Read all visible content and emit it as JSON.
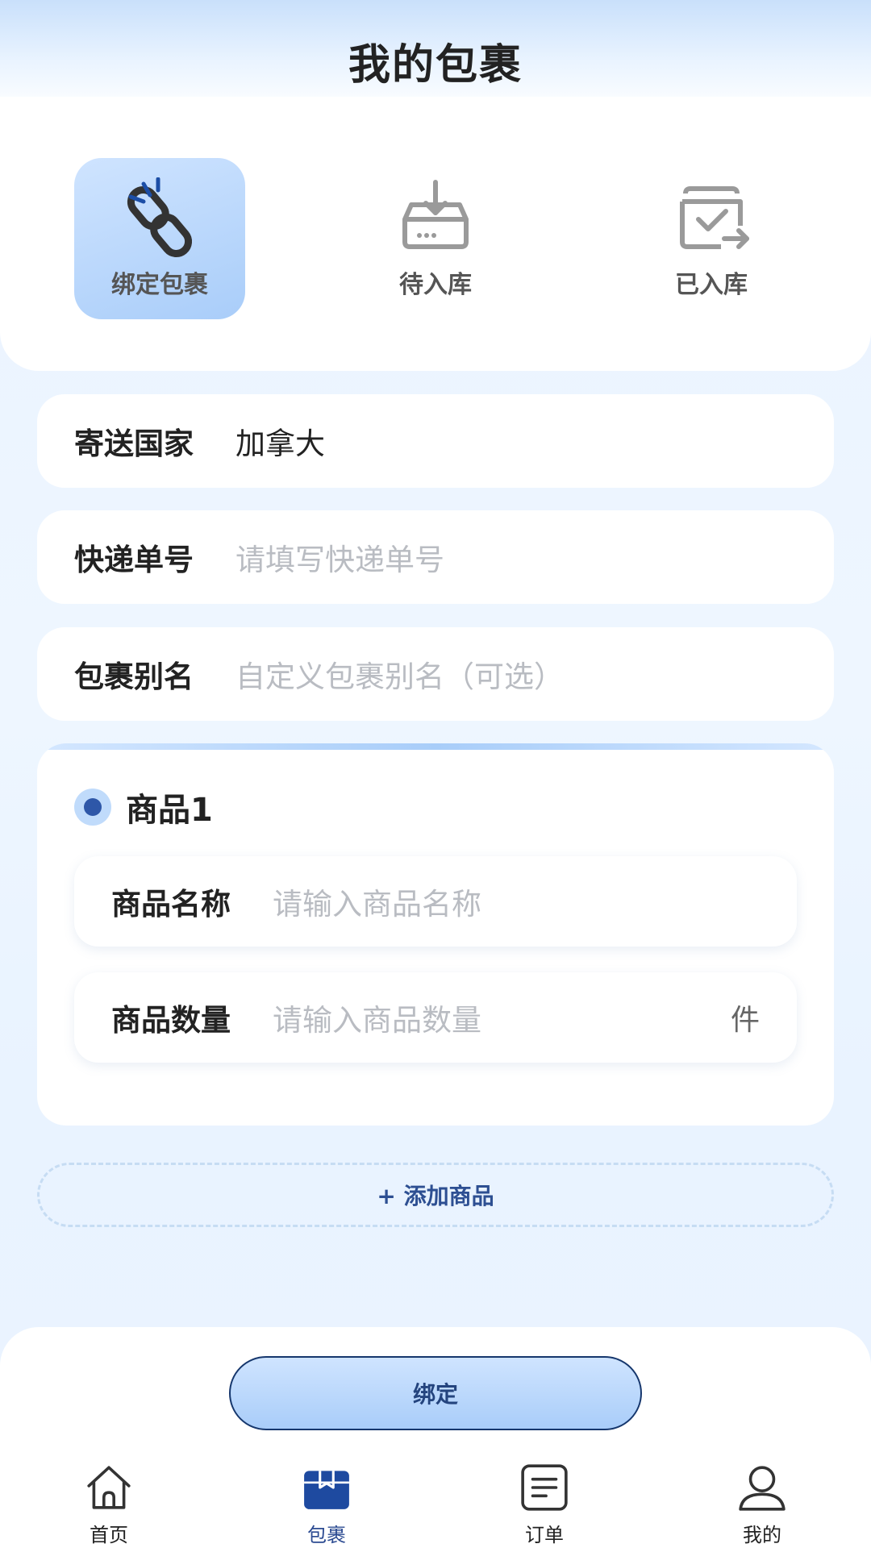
{
  "header": {
    "title": "我的包裹"
  },
  "tabs": [
    {
      "label": "绑定包裹",
      "icon": "link-icon",
      "active": true
    },
    {
      "label": "待入库",
      "icon": "inbox-download-icon",
      "active": false
    },
    {
      "label": "已入库",
      "icon": "box-check-icon",
      "active": false
    }
  ],
  "form": {
    "country": {
      "label": "寄送国家",
      "value": "加拿大"
    },
    "tracking": {
      "label": "快递单号",
      "placeholder": "请填写快递单号"
    },
    "alias": {
      "label": "包裹别名",
      "placeholder": "自定义包裹别名（可选）"
    }
  },
  "goods": {
    "title": "商品1",
    "name": {
      "label": "商品名称",
      "placeholder": "请输入商品名称"
    },
    "quantity": {
      "label": "商品数量",
      "placeholder": "请输入商品数量",
      "unit": "件"
    },
    "add_label": "+ 添加商品"
  },
  "bind_button": {
    "label": "绑定"
  },
  "nav": [
    {
      "label": "首页",
      "icon": "home-icon",
      "active": false
    },
    {
      "label": "包裹",
      "icon": "package-icon",
      "active": true
    },
    {
      "label": "订单",
      "icon": "order-icon",
      "active": false
    },
    {
      "label": "我的",
      "icon": "user-icon",
      "active": false
    }
  ],
  "colors": {
    "accent": "#2e57a8",
    "active_tab_bg": "#a9cdf9",
    "placeholder": "#b9bcc2",
    "nav_active": "#1e4aa0"
  }
}
